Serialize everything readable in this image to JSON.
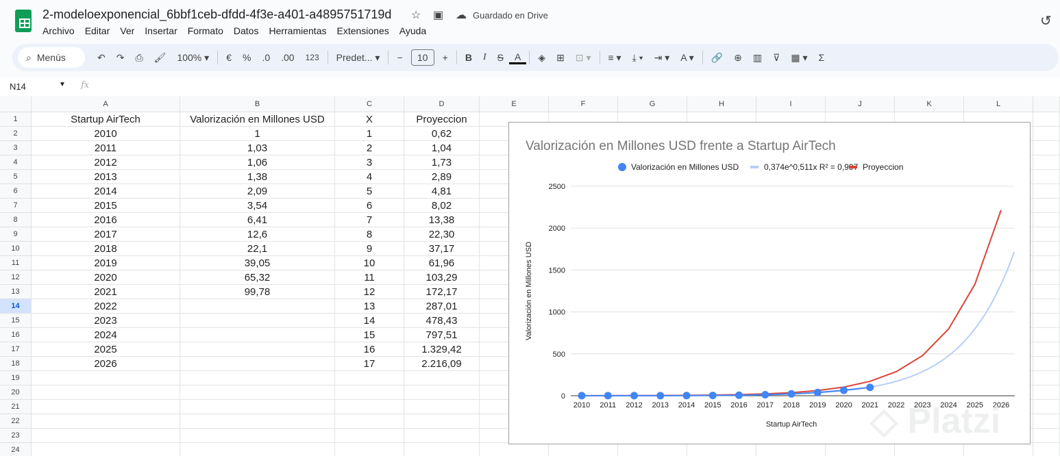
{
  "app": {
    "title": "2-modeloexponencial_6bbf1ceb-dfdd-4f3e-a401-a4895751719d",
    "saved_status": "Guardado en Drive",
    "menu": [
      "Archivo",
      "Editar",
      "Ver",
      "Insertar",
      "Formato",
      "Datos",
      "Herramientas",
      "Extensiones",
      "Ayuda"
    ]
  },
  "toolbar": {
    "search_label": "Menús",
    "zoom": "100%",
    "currency": "€",
    "percent": "%",
    "dec_decrease": ".0",
    "dec_increase": ".00",
    "number_format": "123",
    "font": "Predet...",
    "font_size": "10",
    "bold": "B",
    "italic": "I",
    "sum": "Σ"
  },
  "formula_bar": {
    "name_box": "N14",
    "fx": "fx",
    "value": ""
  },
  "sheet": {
    "columns": [
      "A",
      "B",
      "C",
      "D",
      "E",
      "F",
      "G",
      "H",
      "I",
      "J",
      "K",
      "L"
    ],
    "rows": [
      [
        "Startup AirTech",
        "Valorización en Millones USD",
        "X",
        "Proyeccion"
      ],
      [
        "2010",
        "1",
        "1",
        "0,62"
      ],
      [
        "2011",
        "1,03",
        "2",
        "1,04"
      ],
      [
        "2012",
        "1,06",
        "3",
        "1,73"
      ],
      [
        "2013",
        "1,38",
        "4",
        "2,89"
      ],
      [
        "2014",
        "2,09",
        "5",
        "4,81"
      ],
      [
        "2015",
        "3,54",
        "6",
        "8,02"
      ],
      [
        "2016",
        "6,41",
        "7",
        "13,38"
      ],
      [
        "2017",
        "12,6",
        "8",
        "22,30"
      ],
      [
        "2018",
        "22,1",
        "9",
        "37,17"
      ],
      [
        "2019",
        "39,05",
        "10",
        "61,96"
      ],
      [
        "2020",
        "65,32",
        "11",
        "103,29"
      ],
      [
        "2021",
        "99,78",
        "12",
        "172,17"
      ],
      [
        "2022",
        "",
        "13",
        "287,01"
      ],
      [
        "2023",
        "",
        "14",
        "478,43"
      ],
      [
        "2024",
        "",
        "15",
        "797,51"
      ],
      [
        "2025",
        "",
        "16",
        "1.329,42"
      ],
      [
        "2026",
        "",
        "17",
        "2.216,09"
      ],
      [
        "",
        "",
        "",
        ""
      ],
      [
        "",
        "",
        "",
        ""
      ],
      [
        "",
        "",
        "",
        ""
      ],
      [
        "",
        "",
        "",
        ""
      ],
      [
        "",
        "",
        "",
        ""
      ],
      [
        "",
        "",
        "",
        ""
      ]
    ],
    "selected_row": 14
  },
  "chart_data": {
    "type": "line",
    "title": "Valorización en Millones USD frente a Startup AirTech",
    "xlabel": "Startup AirTech",
    "ylabel": "Valorización en Millones USD",
    "categories": [
      "2010",
      "2011",
      "2012",
      "2013",
      "2014",
      "2015",
      "2016",
      "2017",
      "2018",
      "2019",
      "2020",
      "2021",
      "2022",
      "2023",
      "2024",
      "2025",
      "2026"
    ],
    "ylim": [
      0,
      2500
    ],
    "yticks": [
      "0",
      "500",
      "1000",
      "1500",
      "2000",
      "2500"
    ],
    "legend_position": "top",
    "series": [
      {
        "name": "Valorización en Millones USD",
        "kind": "line+markers",
        "color": "#4285f4",
        "values": [
          1,
          1.03,
          1.06,
          1.38,
          2.09,
          3.54,
          6.41,
          12.6,
          22.1,
          39.05,
          65.32,
          99.78
        ]
      },
      {
        "name": "0,374e^0,511x R² = 0,997",
        "kind": "trendline",
        "color": "#b7cef5",
        "a": 0.374,
        "b": 0.511
      },
      {
        "name": "Proyeccion",
        "kind": "line",
        "color": "#db4437",
        "values": [
          0.62,
          1.04,
          1.73,
          2.89,
          4.81,
          8.02,
          13.38,
          22.3,
          37.17,
          61.96,
          103.29,
          172.17,
          287.01,
          478.43,
          797.51,
          1329.42,
          2216.09
        ]
      }
    ]
  },
  "watermark": "Platzi"
}
